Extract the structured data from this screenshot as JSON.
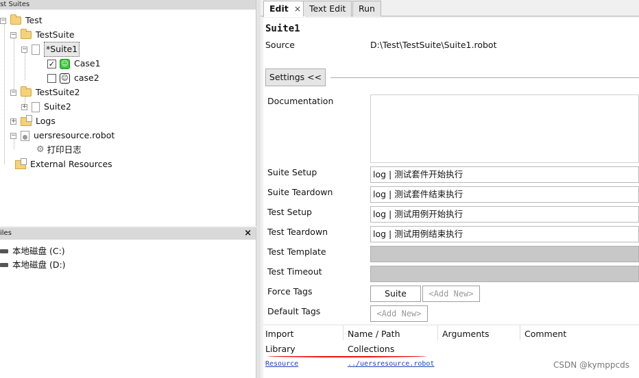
{
  "tree_panel": {
    "header": "est Suites",
    "nodes": {
      "test": "Test",
      "testsuite": "TestSuite",
      "suite1": "*Suite1",
      "case1": "Case1",
      "case2": "case2",
      "testsuite2": "TestSuite2",
      "suite2": "Suite2",
      "logs": "Logs",
      "resource": "uersresource.robot",
      "keyword": "打印日志",
      "external": "External Resources"
    },
    "case1_checked": true,
    "case2_checked": false
  },
  "files_panel": {
    "header": "iles",
    "close": "×",
    "drives": [
      "本地磁盘 (C:)",
      "本地磁盘 (D:)"
    ]
  },
  "tabs": [
    {
      "label": "Edit",
      "active": true,
      "close": "×"
    },
    {
      "label": "Text Edit",
      "active": false
    },
    {
      "label": "Run",
      "active": false
    }
  ],
  "editor": {
    "suite_name": "Suite1",
    "source_label": "Source",
    "source_path": "D:\\Test\\TestSuite\\Suite1.robot",
    "settings_button": "Settings <<",
    "documentation_label": "Documentation",
    "suite_setup_label": "Suite Setup",
    "suite_setup_value": "log | 测试套件开始执行",
    "suite_teardown_label": "Suite Teardown",
    "suite_teardown_value": "log | 测试套件结束执行",
    "test_setup_label": "Test Setup",
    "test_setup_value": "log | 测试用例开始执行",
    "test_teardown_label": "Test Teardown",
    "test_teardown_value": "log | 测试用例结束执行",
    "test_template_label": "Test Template",
    "test_timeout_label": "Test Timeout",
    "force_tags_label": "Force Tags",
    "force_tag": "Suite",
    "add_new": "<Add New>",
    "default_tags_label": "Default Tags"
  },
  "import_table": {
    "headers": [
      "Import",
      "Name / Path",
      "Arguments",
      "Comment"
    ],
    "rows": [
      [
        "Library",
        "Collections",
        "",
        ""
      ],
      [
        "Resource",
        "../uersresource.robot",
        "",
        ""
      ]
    ]
  },
  "watermark": "CSDN @kymppcds",
  "colors": {
    "link": "#1a3fbf",
    "annotation": "#e11111",
    "case_green": "#3cc73c"
  }
}
